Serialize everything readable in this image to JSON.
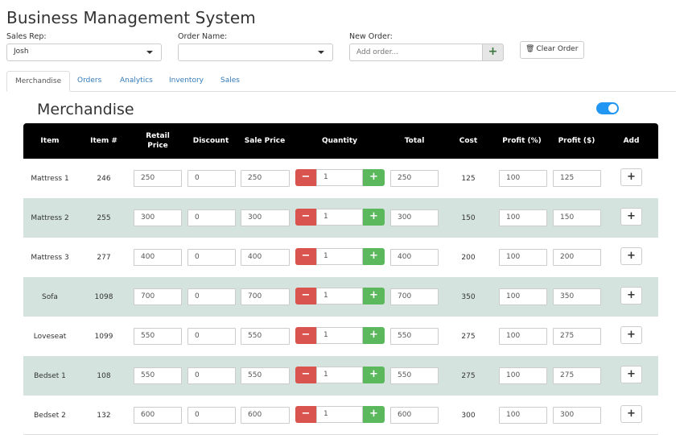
{
  "app": {
    "title": "Business Management System"
  },
  "form": {
    "sales_rep": {
      "label": "Sales Rep:",
      "value": "Josh"
    },
    "order_name": {
      "label": "Order Name:",
      "value": ""
    },
    "new_order": {
      "label": "New Order:",
      "placeholder": "Add order...",
      "add_label": "+"
    },
    "clear_order": {
      "label": "Clear Order",
      "icon": "trash-icon"
    }
  },
  "tabs": [
    {
      "label": "Merchandise",
      "active": true
    },
    {
      "label": "Orders",
      "active": false
    },
    {
      "label": "Analytics",
      "active": false
    },
    {
      "label": "Inventory",
      "active": false
    },
    {
      "label": "Sales",
      "active": false
    }
  ],
  "section": {
    "title": "Merchandise",
    "toggle_on": true
  },
  "colors": {
    "header_bg": "#000000",
    "shaded_row": "#d4e3dd",
    "minus": "#d9534f",
    "plus": "#5cb85c",
    "toggle": "#2196f3",
    "link": "#337ab7"
  },
  "table": {
    "headers": {
      "item": "Item",
      "item_no": "Item #",
      "retail_line1": "Retail",
      "retail_line2": "Price",
      "discount": "Discount",
      "sale_price": "Sale Price",
      "quantity": "Quantity",
      "total": "Total",
      "cost": "Cost",
      "profit_pct": "Profit (%)",
      "profit_dollar": "Profit ($)",
      "add": "Add"
    },
    "buttons": {
      "minus": "−",
      "plus": "+",
      "add": "+"
    },
    "rows": [
      {
        "item": "Mattress 1",
        "item_no": "246",
        "retail": "250",
        "discount": "0",
        "sale": "250",
        "qty": "1",
        "total": "250",
        "cost": "125",
        "profit_pct": "100",
        "profit_dollar": "125"
      },
      {
        "item": "Mattress 2",
        "item_no": "255",
        "retail": "300",
        "discount": "0",
        "sale": "300",
        "qty": "1",
        "total": "300",
        "cost": "150",
        "profit_pct": "100",
        "profit_dollar": "150"
      },
      {
        "item": "Mattress 3",
        "item_no": "277",
        "retail": "400",
        "discount": "0",
        "sale": "400",
        "qty": "1",
        "total": "400",
        "cost": "200",
        "profit_pct": "100",
        "profit_dollar": "200"
      },
      {
        "item": "Sofa",
        "item_no": "1098",
        "retail": "700",
        "discount": "0",
        "sale": "700",
        "qty": "1",
        "total": "700",
        "cost": "350",
        "profit_pct": "100",
        "profit_dollar": "350"
      },
      {
        "item": "Loveseat",
        "item_no": "1099",
        "retail": "550",
        "discount": "0",
        "sale": "550",
        "qty": "1",
        "total": "550",
        "cost": "275",
        "profit_pct": "100",
        "profit_dollar": "275"
      },
      {
        "item": "Bedset 1",
        "item_no": "108",
        "retail": "550",
        "discount": "0",
        "sale": "550",
        "qty": "1",
        "total": "550",
        "cost": "275",
        "profit_pct": "100",
        "profit_dollar": "275"
      },
      {
        "item": "Bedset 2",
        "item_no": "132",
        "retail": "600",
        "discount": "0",
        "sale": "600",
        "qty": "1",
        "total": "600",
        "cost": "300",
        "profit_pct": "100",
        "profit_dollar": "300"
      }
    ]
  }
}
